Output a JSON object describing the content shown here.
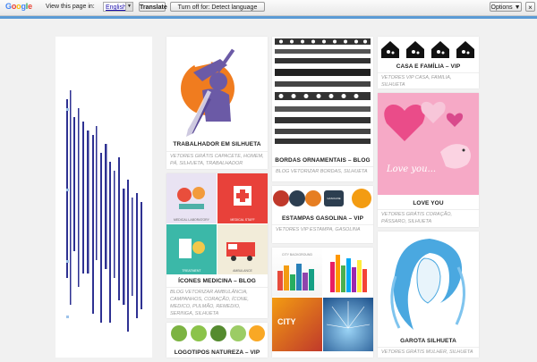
{
  "translate_bar": {
    "logo_letters": [
      {
        "ch": "G",
        "color": "#4285f4"
      },
      {
        "ch": "o",
        "color": "#ea4335"
      },
      {
        "ch": "o",
        "color": "#fbbc05"
      },
      {
        "ch": "g",
        "color": "#4285f4"
      },
      {
        "ch": "l",
        "color": "#34a853"
      },
      {
        "ch": "e",
        "color": "#ea4335"
      }
    ],
    "label": "View this page in:",
    "language": "English",
    "translate_button": "Translate",
    "turn_off_button": "Turn off for: Detect language",
    "options_button": "Options ▼"
  },
  "cards": {
    "trabalhador": {
      "title": "TRABALHADOR EM SILHUETA",
      "meta": "VETORES GRÁTIS  CAPACETE, HOMEM, PÁ, SILHUETA, TRABALHADOR"
    },
    "icones": {
      "title": "ÍCONES MEDICINA – BLOG",
      "meta": "BLOG VETORIZAR  AMBULÂNCIA, CAMPANHOS, CORAÇÃO, ÍCONE, MEDICO, PULMÃO, REMEDIO, SERINGA, SILHUETA",
      "tile_labels": [
        "MEDICAL LABORATORY",
        "MEDICAL STAFF",
        "TREATMENT",
        "AMBULANCE"
      ]
    },
    "logotipos": {
      "title": "LOGOTIPOS NATUREZA – VIP"
    },
    "bordas": {
      "title": "BORDAS ORNAMENTAIS – BLOG",
      "meta": "BLOG VETORIZAR  BORDAS, SILHUETA"
    },
    "gasolina": {
      "title": "ESTAMPAS GASOLINA – VIP",
      "meta": "VETORES VIP  ESTAMPA, GASOLINA",
      "badge_text": "GASOLINE"
    },
    "city": {
      "top_label": "CITY BACKGROUND",
      "tile_word": "CITY"
    },
    "casa": {
      "title": "CASA E FAMÍLIA – VIP",
      "meta": "VETORES VIP  CASA, FAMILIA, SILHUETA"
    },
    "love": {
      "title": "LOVE YOU",
      "meta": "VETORES GRÁTIS  CORAÇÃO, PÁSSARO, SILHUETA",
      "image_text": "Love you..."
    },
    "garota": {
      "title": "GAROTA SILHUETA",
      "meta": "VETORES GRÁTIS  MULHER, SILHUETA"
    }
  },
  "colors": {
    "accent_strip": "#5b9bd5",
    "ad_bars": "#2e3192",
    "love_bg": "#f6a9c6",
    "garota_blue": "#4aa8e0"
  }
}
